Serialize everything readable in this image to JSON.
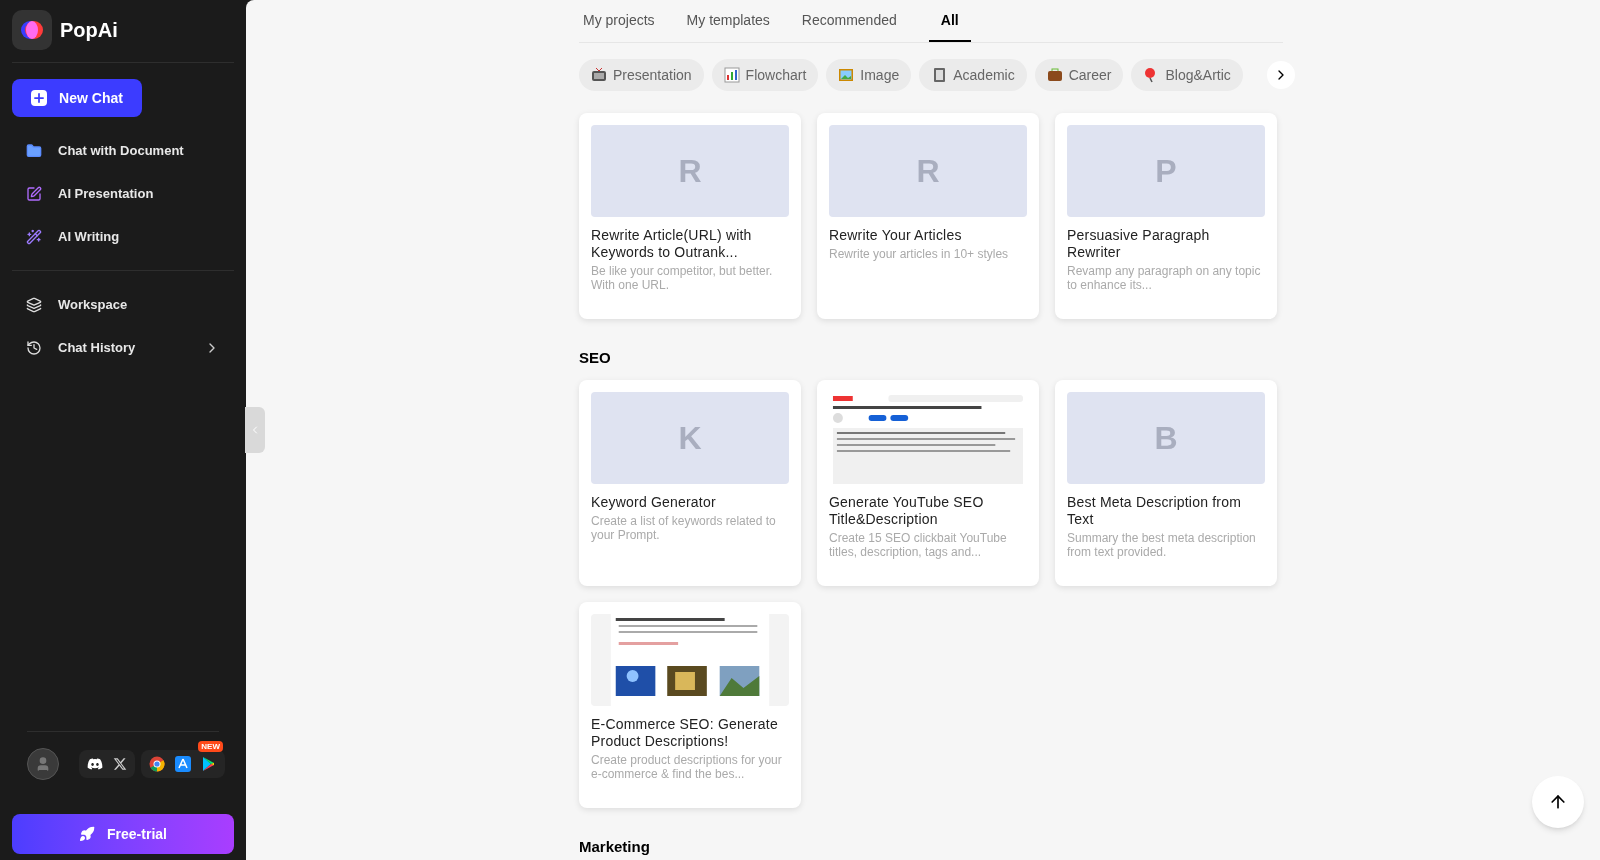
{
  "brand": {
    "name": "PopAi"
  },
  "sidebar": {
    "new_chat": "New Chat",
    "items": [
      {
        "label": "Chat with Document"
      },
      {
        "label": "AI Presentation"
      },
      {
        "label": "AI Writing"
      }
    ],
    "secondary_items": [
      {
        "label": "Workspace",
        "expandable": false
      },
      {
        "label": "Chat History",
        "expandable": true
      }
    ],
    "new_badge": "NEW",
    "cta": "Free-trial"
  },
  "tabs": [
    {
      "label": "My projects",
      "selected": false
    },
    {
      "label": "My templates",
      "selected": false
    },
    {
      "label": "Recommended",
      "selected": false
    },
    {
      "label": "All",
      "selected": true
    }
  ],
  "categories": [
    {
      "label": "Presentation"
    },
    {
      "label": "Flowchart"
    },
    {
      "label": "Image"
    },
    {
      "label": "Academic"
    },
    {
      "label": "Career"
    },
    {
      "label": "Blog&Artic"
    }
  ],
  "sections": [
    {
      "cards": [
        {
          "thumb": {
            "kind": "letter",
            "letter": "R"
          },
          "title": "Rewrite Article(URL) with Keywords to Outrank...",
          "description": "Be like your competitor, but better. With one URL."
        },
        {
          "thumb": {
            "kind": "letter",
            "letter": "R"
          },
          "title": "Rewrite Your Articles",
          "description": "Rewrite your articles in 10+ styles"
        },
        {
          "thumb": {
            "kind": "letter",
            "letter": "P"
          },
          "title": "Persuasive Paragraph Rewriter",
          "description": "Revamp any paragraph on any topic to enhance its..."
        }
      ]
    },
    {
      "title": "SEO",
      "cards": [
        {
          "thumb": {
            "kind": "letter",
            "letter": "K"
          },
          "title": "Keyword Generator",
          "description": "Create a list of keywords related to your Prompt."
        },
        {
          "title": "Generate YouTube SEO Title&Description",
          "description": "Create 15 SEO clickbait YouTube titles, description, tags and..."
        },
        {
          "thumb": {
            "kind": "letter",
            "letter": "B"
          },
          "title": "Best Meta Description from Text",
          "description": "Summary the best meta description from text provided."
        },
        {
          "title": "E-Commerce SEO: Generate Product Descriptions!",
          "description": "Create product descriptions for your e-commerce & find the bes..."
        }
      ]
    },
    {
      "title": "Marketing"
    }
  ]
}
